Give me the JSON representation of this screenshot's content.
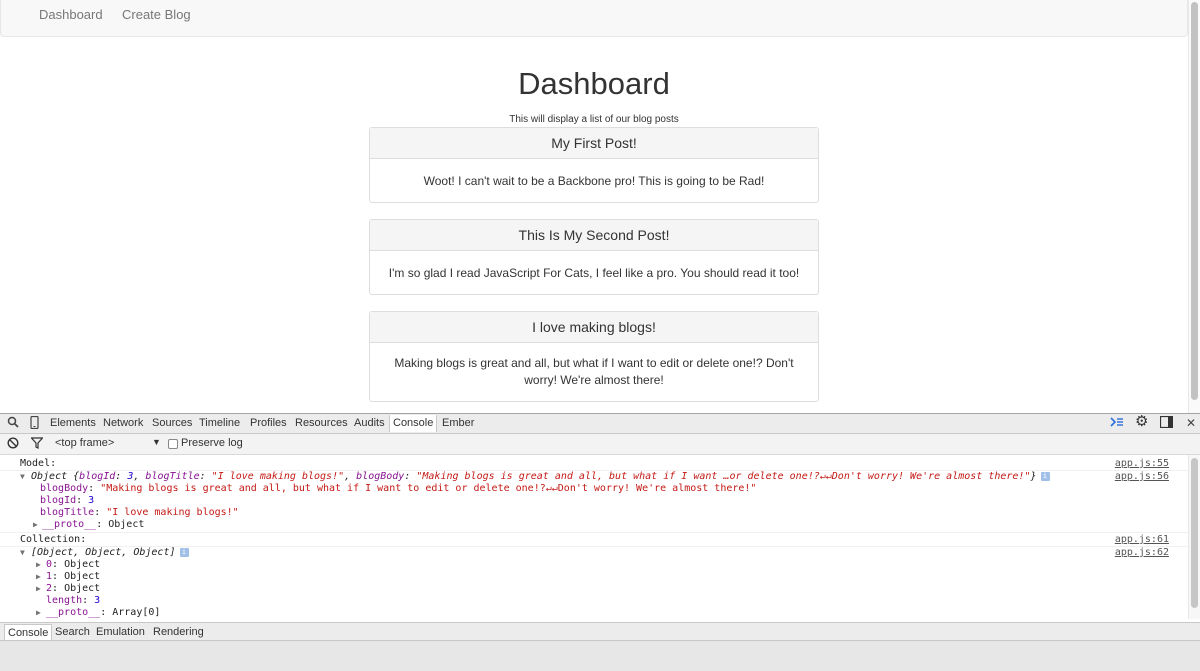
{
  "nav": {
    "dashboard_label": "Dashboard",
    "create_blog_label": "Create Blog"
  },
  "page": {
    "title": "Dashboard",
    "subtitle": "This will display a list of our blog posts"
  },
  "posts": [
    {
      "title": "My First Post!",
      "body": "Woot! I can't wait to be a Backbone pro! This is going to be Rad!"
    },
    {
      "title": "This Is My Second Post!",
      "body": "I'm so glad I read JavaScript For Cats, I feel like a pro. You should read it too!"
    },
    {
      "title": "I love making blogs!",
      "body": "Making blogs is great and all, but what if I want to edit or delete one!? Don't worry! We're almost there!"
    }
  ],
  "devtools": {
    "tabs": [
      "Elements",
      "Network",
      "Sources",
      "Timeline",
      "Profiles",
      "Resources",
      "Audits",
      "Console",
      "Ember"
    ],
    "active_tab": "Console",
    "toolbar": {
      "frame": "<top frame>",
      "preserve_log": "Preserve log"
    },
    "console": {
      "model_label": "Model:",
      "model_label_src": "app.js:55",
      "object_prefix": "Object {",
      "k_blogId": "blogId",
      "v_blogId": "3",
      "k_blogTitle": "blogTitle",
      "v_blogTitle": "\"I love making blogs!\"",
      "k_blogBody": "blogBody",
      "v_blogBody_short": "\"Making blogs is great and all, but what if I want …or delete one!?↵↵Don't worry! We're almost there!\"",
      "object_suffix": "}",
      "object_src": "app.js:56",
      "v_blogBody_full": "\"Making blogs is great and all, but what if I want to edit or delete one!?↵↵Don't worry! We're almost there!\"",
      "k_proto": "__proto__",
      "v_proto_object": "Object",
      "collection_label": "Collection:",
      "collection_label_src": "app.js:61",
      "array_summary": "[Object, Object, Object]",
      "array_src": "app.js:62",
      "k_0": "0",
      "k_1": "1",
      "k_2": "2",
      "v_item": "Object",
      "k_length": "length",
      "v_length": "3",
      "v_proto_array": "Array[0]",
      "info_badge": "i"
    },
    "drawer_tabs": [
      "Console",
      "Search",
      "Emulation",
      "Rendering"
    ],
    "drawer_active": "Console"
  }
}
